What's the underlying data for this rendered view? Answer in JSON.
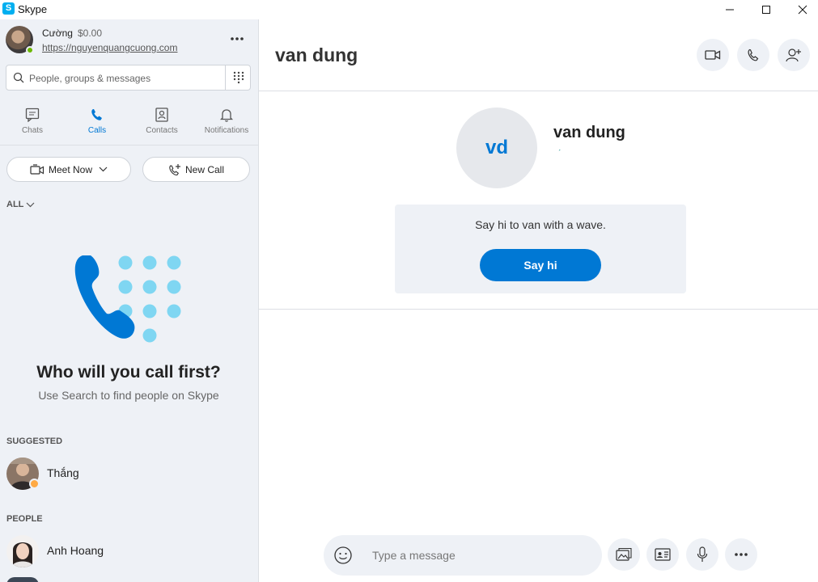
{
  "window": {
    "title": "Skype",
    "logo_letter": "S",
    "controls": [
      "minimize",
      "maximize",
      "close"
    ]
  },
  "profile": {
    "name": "Cường",
    "credit": "$0.00",
    "link": "https://nguyenquangcuong.com",
    "status_color": "#6bb700"
  },
  "search": {
    "placeholder": "People, groups & messages"
  },
  "nav": {
    "tabs": [
      {
        "label": "Chats",
        "icon": "chat-icon",
        "active": false
      },
      {
        "label": "Calls",
        "icon": "phone-icon",
        "active": true
      },
      {
        "label": "Contacts",
        "icon": "contacts-icon",
        "active": false
      },
      {
        "label": "Notifications",
        "icon": "bell-icon",
        "active": false
      }
    ]
  },
  "actions": {
    "meet_now": "Meet Now",
    "new_call": "New Call"
  },
  "filter": {
    "label": "ALL"
  },
  "empty_state": {
    "title": "Who will you call first?",
    "subtitle": "Use Search to find people on Skype"
  },
  "suggested": {
    "label": "SUGGESTED",
    "items": [
      {
        "name": "Thắng",
        "status": "away"
      }
    ]
  },
  "people": {
    "label": "PEOPLE",
    "items": [
      {
        "name": "Anh Hoang"
      }
    ]
  },
  "conversation": {
    "title": "van dung",
    "contact_name": "van dung",
    "initials": "vd",
    "wave_text": "Say hi to van with a wave.",
    "say_hi_label": "Say hi",
    "mood_glyph": "ˊ"
  },
  "composer": {
    "placeholder": "Type a message"
  },
  "colors": {
    "accent": "#0078d4",
    "sidebar_bg": "#eef1f6",
    "art_dots": "#7fd6f2"
  }
}
